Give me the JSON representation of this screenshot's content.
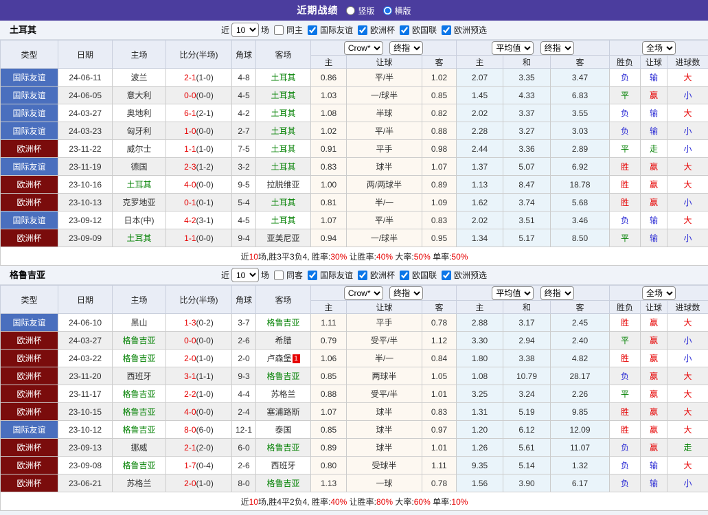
{
  "topbar": {
    "title": "近期战绩",
    "radios": [
      {
        "label": "竖版",
        "selected": false
      },
      {
        "label": "横版",
        "selected": true
      }
    ]
  },
  "colors": {
    "topbar_bg": "#4b3d9e",
    "league_friendly_bg": "#4a6fbe",
    "league_euro_bg": "#7a0c0c",
    "win_red": "#e60000",
    "draw_green": "#008000",
    "lose_blue": "#2a2ad4",
    "self_team_green": "#008000",
    "odds_col_bg": "#fdf8f1",
    "avg_col_bg": "#eaf4fa"
  },
  "table": {
    "left_headers": [
      "类型",
      "日期",
      "主场",
      "比分(半场)",
      "角球",
      "客场"
    ],
    "odds_headers": [
      "主",
      "让球",
      "客"
    ],
    "avg_headers": [
      "主",
      "和",
      "客"
    ],
    "result_headers": [
      "胜负",
      "让球",
      "进球数"
    ],
    "selects": {
      "provider": "Crow*",
      "odds_stage": "终指",
      "avg_type": "平均值",
      "avg_stage": "终指",
      "scope": "全场"
    }
  },
  "sections": [
    {
      "team": "土耳其",
      "filter": {
        "near": "近",
        "count": "10",
        "unit": "场",
        "same": {
          "label": "同主",
          "checked": false
        },
        "competitions": [
          {
            "label": "国际友谊",
            "checked": true
          },
          {
            "label": "欧洲杯",
            "checked": true
          },
          {
            "label": "欧国联",
            "checked": true
          },
          {
            "label": "欧洲预选",
            "checked": true
          }
        ]
      },
      "rows": [
        {
          "league": "国际友谊",
          "league_style": "friendly",
          "date": "24-06-11",
          "home": "波兰",
          "home_is_team": false,
          "score": "2-1",
          "half": "(1-0)",
          "corner": "4-8",
          "away": "土耳其",
          "away_is_team": true,
          "away_red_cards": "",
          "odds": [
            "0.86",
            "平/半",
            "1.02"
          ],
          "avg": [
            "2.07",
            "3.35",
            "3.47"
          ],
          "results": [
            [
              "负",
              "b"
            ],
            [
              "输",
              "b"
            ],
            [
              "大",
              "r"
            ]
          ]
        },
        {
          "league": "国际友谊",
          "league_style": "friendly",
          "date": "24-06-05",
          "home": "意大利",
          "home_is_team": false,
          "score": "0-0",
          "half": "(0-0)",
          "corner": "4-5",
          "away": "土耳其",
          "away_is_team": true,
          "away_red_cards": "",
          "odds": [
            "1.03",
            "一/球半",
            "0.85"
          ],
          "avg": [
            "1.45",
            "4.33",
            "6.83"
          ],
          "results": [
            [
              "平",
              "g"
            ],
            [
              "赢",
              "r"
            ],
            [
              "小",
              "b"
            ]
          ]
        },
        {
          "league": "国际友谊",
          "league_style": "friendly",
          "date": "24-03-27",
          "home": "奥地利",
          "home_is_team": false,
          "score": "6-1",
          "half": "(2-1)",
          "corner": "4-2",
          "away": "土耳其",
          "away_is_team": true,
          "away_red_cards": "",
          "odds": [
            "1.08",
            "半球",
            "0.82"
          ],
          "avg": [
            "2.02",
            "3.37",
            "3.55"
          ],
          "results": [
            [
              "负",
              "b"
            ],
            [
              "输",
              "b"
            ],
            [
              "大",
              "r"
            ]
          ]
        },
        {
          "league": "国际友谊",
          "league_style": "friendly",
          "date": "24-03-23",
          "home": "匈牙利",
          "home_is_team": false,
          "score": "1-0",
          "half": "(0-0)",
          "corner": "2-7",
          "away": "土耳其",
          "away_is_team": true,
          "away_red_cards": "",
          "odds": [
            "1.02",
            "平/半",
            "0.88"
          ],
          "avg": [
            "2.28",
            "3.27",
            "3.03"
          ],
          "results": [
            [
              "负",
              "b"
            ],
            [
              "输",
              "b"
            ],
            [
              "小",
              "b"
            ]
          ]
        },
        {
          "league": "欧洲杯",
          "league_style": "euro",
          "date": "23-11-22",
          "home": "威尔士",
          "home_is_team": false,
          "score": "1-1",
          "half": "(1-0)",
          "corner": "7-5",
          "away": "土耳其",
          "away_is_team": true,
          "away_red_cards": "",
          "odds": [
            "0.91",
            "平手",
            "0.98"
          ],
          "avg": [
            "2.44",
            "3.36",
            "2.89"
          ],
          "results": [
            [
              "平",
              "g"
            ],
            [
              "走",
              "g"
            ],
            [
              "小",
              "b"
            ]
          ]
        },
        {
          "league": "国际友谊",
          "league_style": "friendly",
          "date": "23-11-19",
          "home": "德国",
          "home_is_team": false,
          "score": "2-3",
          "half": "(1-2)",
          "corner": "3-2",
          "away": "土耳其",
          "away_is_team": true,
          "away_red_cards": "",
          "odds": [
            "0.83",
            "球半",
            "1.07"
          ],
          "avg": [
            "1.37",
            "5.07",
            "6.92"
          ],
          "results": [
            [
              "胜",
              "r"
            ],
            [
              "赢",
              "r"
            ],
            [
              "大",
              "r"
            ]
          ]
        },
        {
          "league": "欧洲杯",
          "league_style": "euro",
          "date": "23-10-16",
          "home": "土耳其",
          "home_is_team": true,
          "score": "4-0",
          "half": "(0-0)",
          "corner": "9-5",
          "away": "拉脱维亚",
          "away_is_team": false,
          "away_red_cards": "",
          "odds": [
            "1.00",
            "两/两球半",
            "0.89"
          ],
          "avg": [
            "1.13",
            "8.47",
            "18.78"
          ],
          "results": [
            [
              "胜",
              "r"
            ],
            [
              "赢",
              "r"
            ],
            [
              "大",
              "r"
            ]
          ]
        },
        {
          "league": "欧洲杯",
          "league_style": "euro",
          "date": "23-10-13",
          "home": "克罗地亚",
          "home_is_team": false,
          "score": "0-1",
          "half": "(0-1)",
          "corner": "5-4",
          "away": "土耳其",
          "away_is_team": true,
          "away_red_cards": "",
          "odds": [
            "0.81",
            "半/一",
            "1.09"
          ],
          "avg": [
            "1.62",
            "3.74",
            "5.68"
          ],
          "results": [
            [
              "胜",
              "r"
            ],
            [
              "赢",
              "r"
            ],
            [
              "小",
              "b"
            ]
          ]
        },
        {
          "league": "国际友谊",
          "league_style": "friendly",
          "date": "23-09-12",
          "home": "日本(中)",
          "home_is_team": false,
          "score": "4-2",
          "half": "(3-1)",
          "corner": "4-5",
          "away": "土耳其",
          "away_is_team": true,
          "away_red_cards": "",
          "odds": [
            "1.07",
            "平/半",
            "0.83"
          ],
          "avg": [
            "2.02",
            "3.51",
            "3.46"
          ],
          "results": [
            [
              "负",
              "b"
            ],
            [
              "输",
              "b"
            ],
            [
              "大",
              "r"
            ]
          ]
        },
        {
          "league": "欧洲杯",
          "league_style": "euro",
          "date": "23-09-09",
          "home": "土耳其",
          "home_is_team": true,
          "score": "1-1",
          "half": "(0-0)",
          "corner": "9-4",
          "away": "亚美尼亚",
          "away_is_team": false,
          "away_red_cards": "",
          "odds": [
            "0.94",
            "一/球半",
            "0.95"
          ],
          "avg": [
            "1.34",
            "5.17",
            "8.50"
          ],
          "results": [
            [
              "平",
              "g"
            ],
            [
              "输",
              "b"
            ],
            [
              "小",
              "b"
            ]
          ]
        }
      ],
      "summary": [
        {
          "t": "近",
          "c": "k"
        },
        {
          "t": "10",
          "c": "r"
        },
        {
          "t": "场,胜3平3负4, 胜率:",
          "c": "k"
        },
        {
          "t": "30%",
          "c": "r"
        },
        {
          "t": " 让胜率:",
          "c": "k"
        },
        {
          "t": "40%",
          "c": "r"
        },
        {
          "t": " 大率:",
          "c": "k"
        },
        {
          "t": "50%",
          "c": "r"
        },
        {
          "t": " 单率:",
          "c": "k"
        },
        {
          "t": "50%",
          "c": "r"
        }
      ]
    },
    {
      "team": "格鲁吉亚",
      "filter": {
        "near": "近",
        "count": "10",
        "unit": "场",
        "same": {
          "label": "同客",
          "checked": false
        },
        "competitions": [
          {
            "label": "国际友谊",
            "checked": true
          },
          {
            "label": "欧洲杯",
            "checked": true
          },
          {
            "label": "欧国联",
            "checked": true
          },
          {
            "label": "欧洲预选",
            "checked": true
          }
        ]
      },
      "rows": [
        {
          "league": "国际友谊",
          "league_style": "friendly",
          "date": "24-06-10",
          "home": "黑山",
          "home_is_team": false,
          "score": "1-3",
          "half": "(0-2)",
          "corner": "3-7",
          "away": "格鲁吉亚",
          "away_is_team": true,
          "away_red_cards": "",
          "odds": [
            "1.11",
            "平手",
            "0.78"
          ],
          "avg": [
            "2.88",
            "3.17",
            "2.45"
          ],
          "results": [
            [
              "胜",
              "r"
            ],
            [
              "赢",
              "r"
            ],
            [
              "大",
              "r"
            ]
          ]
        },
        {
          "league": "欧洲杯",
          "league_style": "euro",
          "date": "24-03-27",
          "home": "格鲁吉亚",
          "home_is_team": true,
          "score": "0-0",
          "half": "(0-0)",
          "corner": "2-6",
          "away": "希腊",
          "away_is_team": false,
          "away_red_cards": "",
          "odds": [
            "0.79",
            "受平/半",
            "1.12"
          ],
          "avg": [
            "3.30",
            "2.94",
            "2.40"
          ],
          "results": [
            [
              "平",
              "g"
            ],
            [
              "赢",
              "r"
            ],
            [
              "小",
              "b"
            ]
          ]
        },
        {
          "league": "欧洲杯",
          "league_style": "euro",
          "date": "24-03-22",
          "home": "格鲁吉亚",
          "home_is_team": true,
          "score": "2-0",
          "half": "(1-0)",
          "corner": "2-0",
          "away": "卢森堡",
          "away_is_team": false,
          "away_red_cards": "1",
          "odds": [
            "1.06",
            "半/一",
            "0.84"
          ],
          "avg": [
            "1.80",
            "3.38",
            "4.82"
          ],
          "results": [
            [
              "胜",
              "r"
            ],
            [
              "赢",
              "r"
            ],
            [
              "小",
              "b"
            ]
          ]
        },
        {
          "league": "欧洲杯",
          "league_style": "euro",
          "date": "23-11-20",
          "home": "西班牙",
          "home_is_team": false,
          "score": "3-1",
          "half": "(1-1)",
          "corner": "9-3",
          "away": "格鲁吉亚",
          "away_is_team": true,
          "away_red_cards": "",
          "odds": [
            "0.85",
            "两球半",
            "1.05"
          ],
          "avg": [
            "1.08",
            "10.79",
            "28.17"
          ],
          "results": [
            [
              "负",
              "b"
            ],
            [
              "赢",
              "r"
            ],
            [
              "大",
              "r"
            ]
          ]
        },
        {
          "league": "欧洲杯",
          "league_style": "euro",
          "date": "23-11-17",
          "home": "格鲁吉亚",
          "home_is_team": true,
          "score": "2-2",
          "half": "(1-0)",
          "corner": "4-4",
          "away": "苏格兰",
          "away_is_team": false,
          "away_red_cards": "",
          "odds": [
            "0.88",
            "受平/半",
            "1.01"
          ],
          "avg": [
            "3.25",
            "3.24",
            "2.26"
          ],
          "results": [
            [
              "平",
              "g"
            ],
            [
              "赢",
              "r"
            ],
            [
              "大",
              "r"
            ]
          ]
        },
        {
          "league": "欧洲杯",
          "league_style": "euro",
          "date": "23-10-15",
          "home": "格鲁吉亚",
          "home_is_team": true,
          "score": "4-0",
          "half": "(0-0)",
          "corner": "2-4",
          "away": "塞浦路斯",
          "away_is_team": false,
          "away_red_cards": "",
          "odds": [
            "1.07",
            "球半",
            "0.83"
          ],
          "avg": [
            "1.31",
            "5.19",
            "9.85"
          ],
          "results": [
            [
              "胜",
              "r"
            ],
            [
              "赢",
              "r"
            ],
            [
              "大",
              "r"
            ]
          ]
        },
        {
          "league": "国际友谊",
          "league_style": "friendly",
          "date": "23-10-12",
          "home": "格鲁吉亚",
          "home_is_team": true,
          "score": "8-0",
          "half": "(6-0)",
          "corner": "12-1",
          "away": "泰国",
          "away_is_team": false,
          "away_red_cards": "",
          "odds": [
            "0.85",
            "球半",
            "0.97"
          ],
          "avg": [
            "1.20",
            "6.12",
            "12.09"
          ],
          "results": [
            [
              "胜",
              "r"
            ],
            [
              "赢",
              "r"
            ],
            [
              "大",
              "r"
            ]
          ]
        },
        {
          "league": "欧洲杯",
          "league_style": "euro",
          "date": "23-09-13",
          "home": "挪威",
          "home_is_team": false,
          "score": "2-1",
          "half": "(2-0)",
          "corner": "6-0",
          "away": "格鲁吉亚",
          "away_is_team": true,
          "away_red_cards": "",
          "odds": [
            "0.89",
            "球半",
            "1.01"
          ],
          "avg": [
            "1.26",
            "5.61",
            "11.07"
          ],
          "results": [
            [
              "负",
              "b"
            ],
            [
              "赢",
              "r"
            ],
            [
              "走",
              "g"
            ]
          ]
        },
        {
          "league": "欧洲杯",
          "league_style": "euro",
          "date": "23-09-08",
          "home": "格鲁吉亚",
          "home_is_team": true,
          "score": "1-7",
          "half": "(0-4)",
          "corner": "2-6",
          "away": "西班牙",
          "away_is_team": false,
          "away_red_cards": "",
          "odds": [
            "0.80",
            "受球半",
            "1.11"
          ],
          "avg": [
            "9.35",
            "5.14",
            "1.32"
          ],
          "results": [
            [
              "负",
              "b"
            ],
            [
              "输",
              "b"
            ],
            [
              "大",
              "r"
            ]
          ]
        },
        {
          "league": "欧洲杯",
          "league_style": "euro",
          "date": "23-06-21",
          "home": "苏格兰",
          "home_is_team": false,
          "score": "2-0",
          "half": "(1-0)",
          "corner": "8-0",
          "away": "格鲁吉亚",
          "away_is_team": true,
          "away_red_cards": "",
          "odds": [
            "1.13",
            "一球",
            "0.78"
          ],
          "avg": [
            "1.56",
            "3.90",
            "6.17"
          ],
          "results": [
            [
              "负",
              "b"
            ],
            [
              "输",
              "b"
            ],
            [
              "小",
              "b"
            ]
          ]
        }
      ],
      "summary": [
        {
          "t": "近",
          "c": "k"
        },
        {
          "t": "10",
          "c": "r"
        },
        {
          "t": "场,胜4平2负4, 胜率:",
          "c": "k"
        },
        {
          "t": "40%",
          "c": "r"
        },
        {
          "t": " 让胜率:",
          "c": "k"
        },
        {
          "t": "80%",
          "c": "r"
        },
        {
          "t": " 大率:",
          "c": "k"
        },
        {
          "t": "60%",
          "c": "r"
        },
        {
          "t": " 单率:",
          "c": "k"
        },
        {
          "t": "10%",
          "c": "r"
        }
      ]
    }
  ]
}
